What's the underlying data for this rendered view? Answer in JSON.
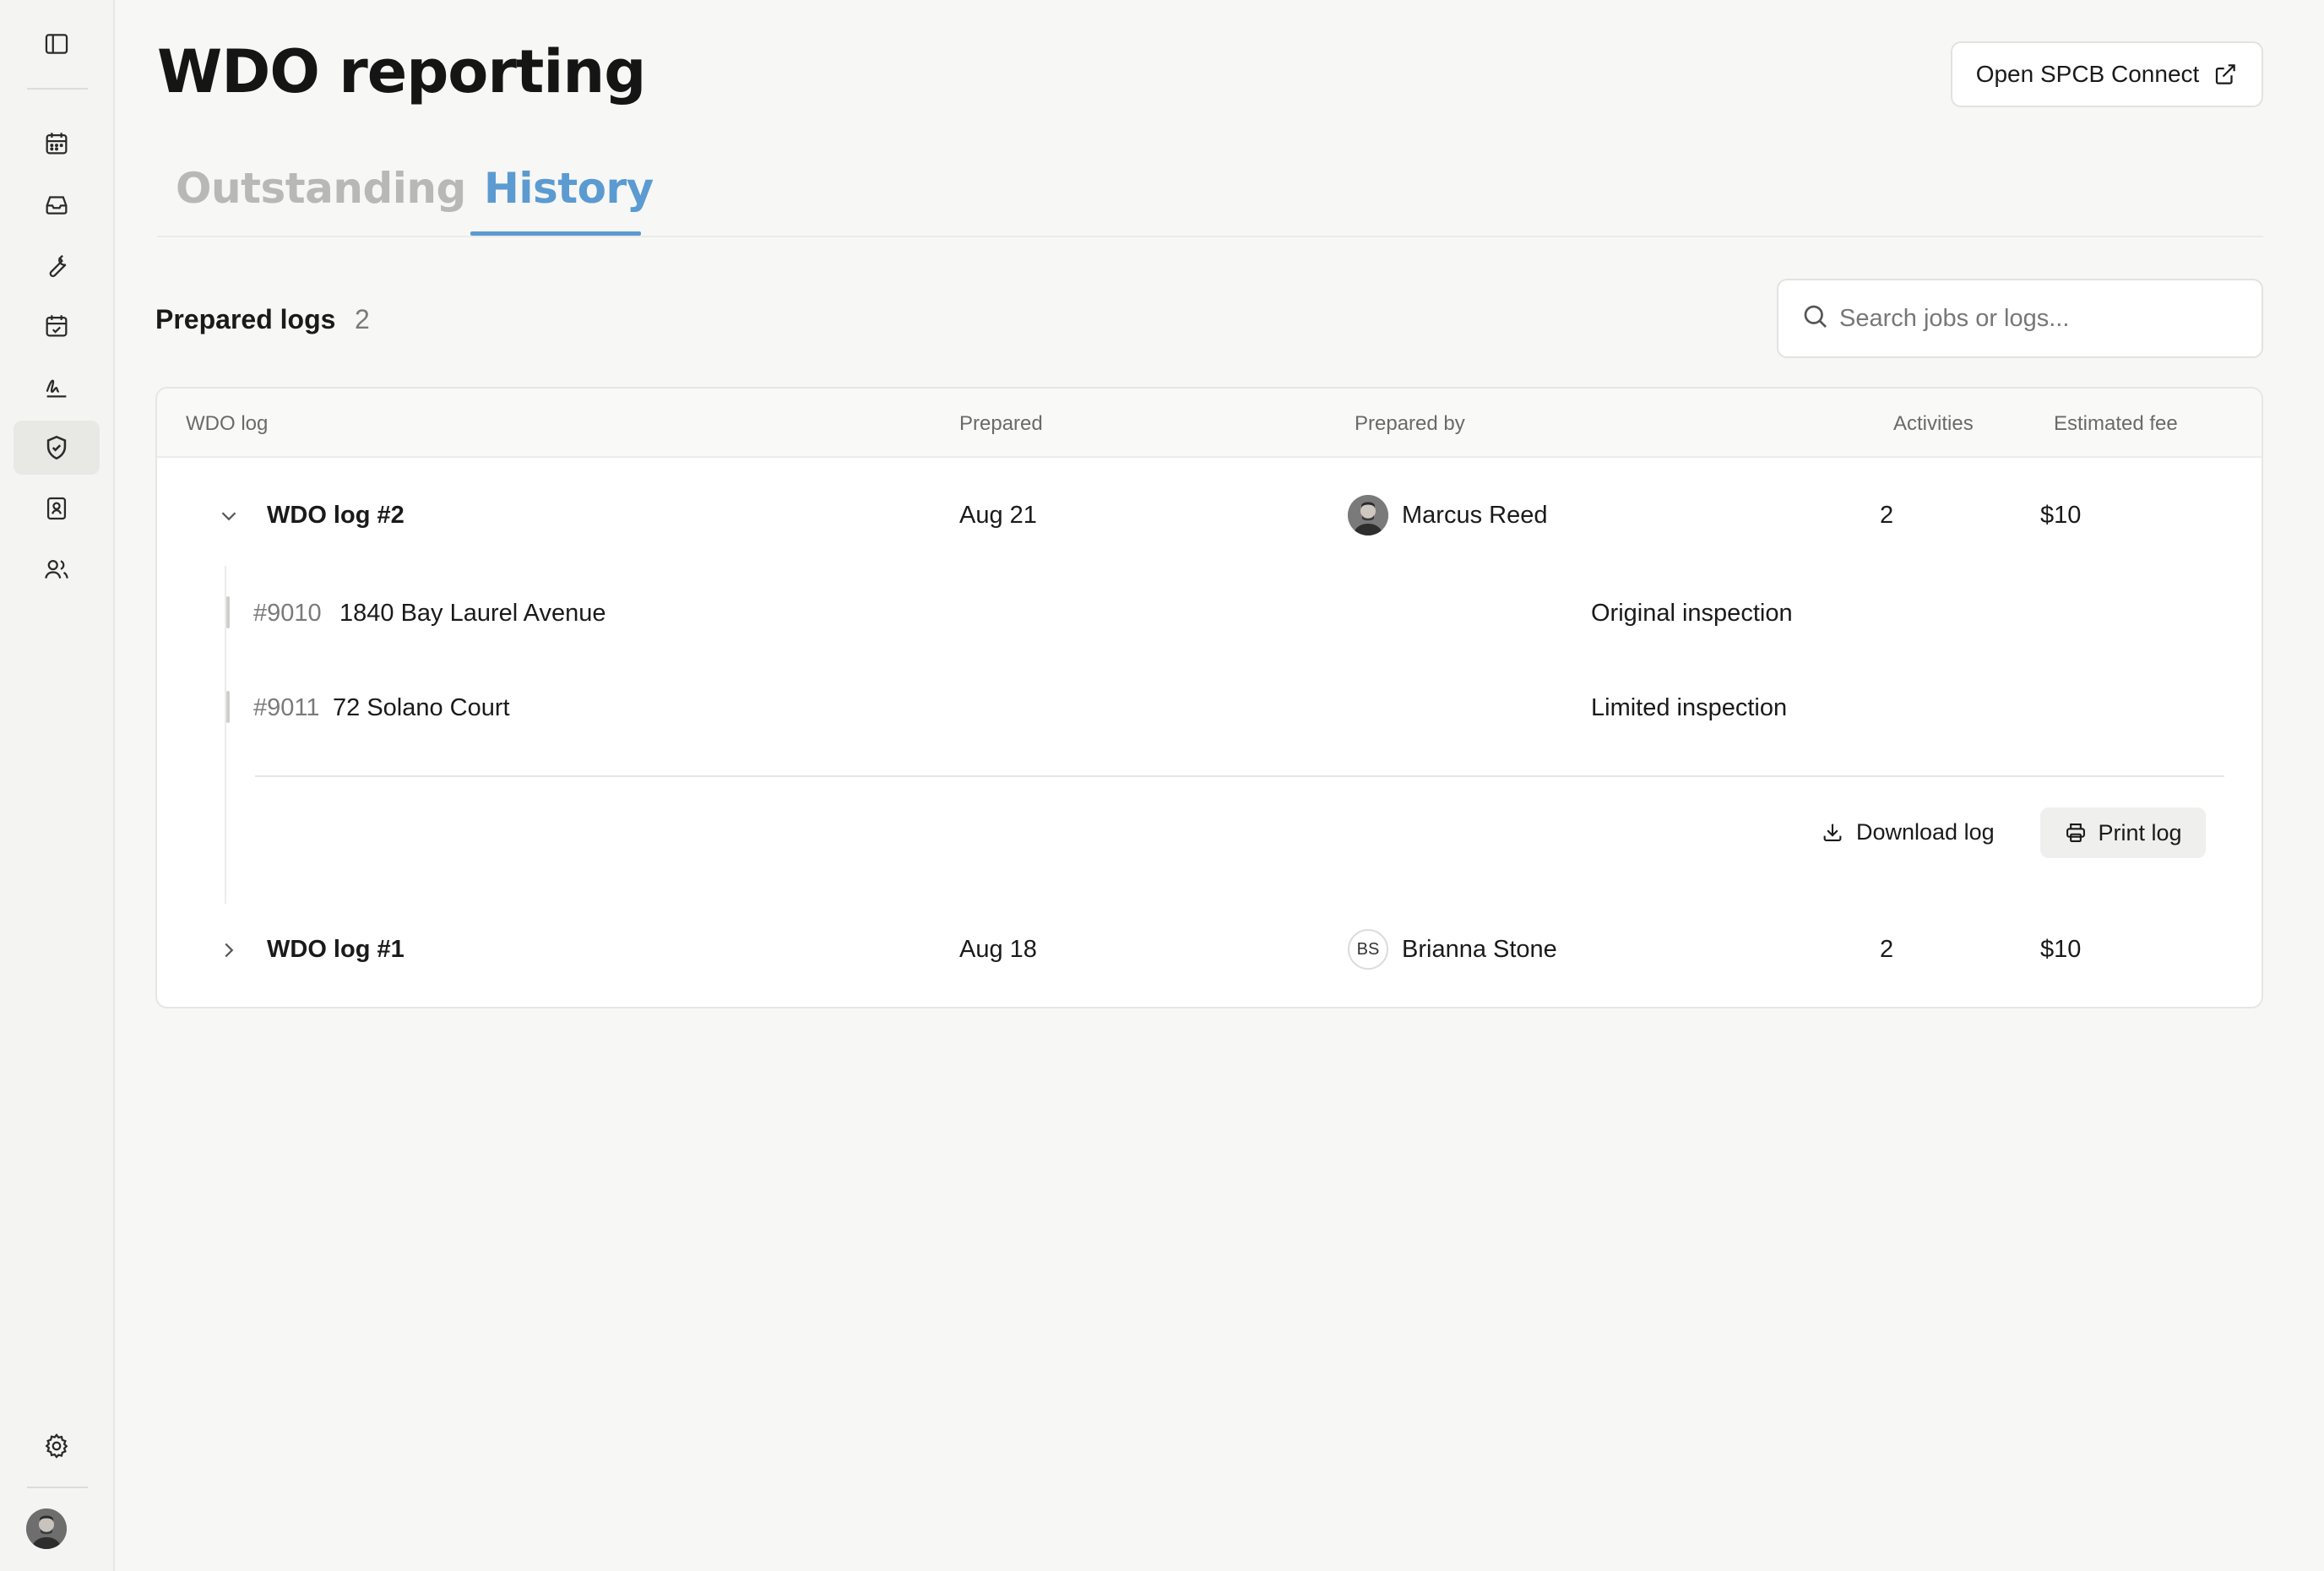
{
  "page": {
    "title": "WDO reporting",
    "open_button": "Open SPCB Connect"
  },
  "tabs": [
    {
      "label": "Outstanding",
      "active": false
    },
    {
      "label": "History",
      "active": true
    }
  ],
  "section": {
    "title": "Prepared logs",
    "count": "2"
  },
  "search": {
    "placeholder": "Search jobs or logs..."
  },
  "table": {
    "headers": {
      "log": "WDO log",
      "prepared": "Prepared",
      "prepared_by": "Prepared by",
      "activities": "Activities",
      "fee": "Estimated fee"
    },
    "rows": [
      {
        "name": "WDO log #2",
        "prepared": "Aug 21",
        "prepared_by": "Marcus Reed",
        "activities": "2",
        "fee": "$10",
        "expanded": true,
        "items": [
          {
            "id": "#9010",
            "address": "1840 Bay Laurel Avenue",
            "type": "Original inspection"
          },
          {
            "id": "#9011",
            "address": "72 Solano Court",
            "type": "Limited inspection"
          }
        ],
        "download_label": "Download log",
        "print_label": "Print log"
      },
      {
        "name": "WDO log #1",
        "prepared": "Aug 18",
        "prepared_by": "Brianna Stone",
        "initials": "BS",
        "activities": "2",
        "fee": "$10",
        "expanded": false
      }
    ]
  },
  "colors": {
    "accent": "#5b9bd1",
    "background": "#f7f7f5"
  }
}
